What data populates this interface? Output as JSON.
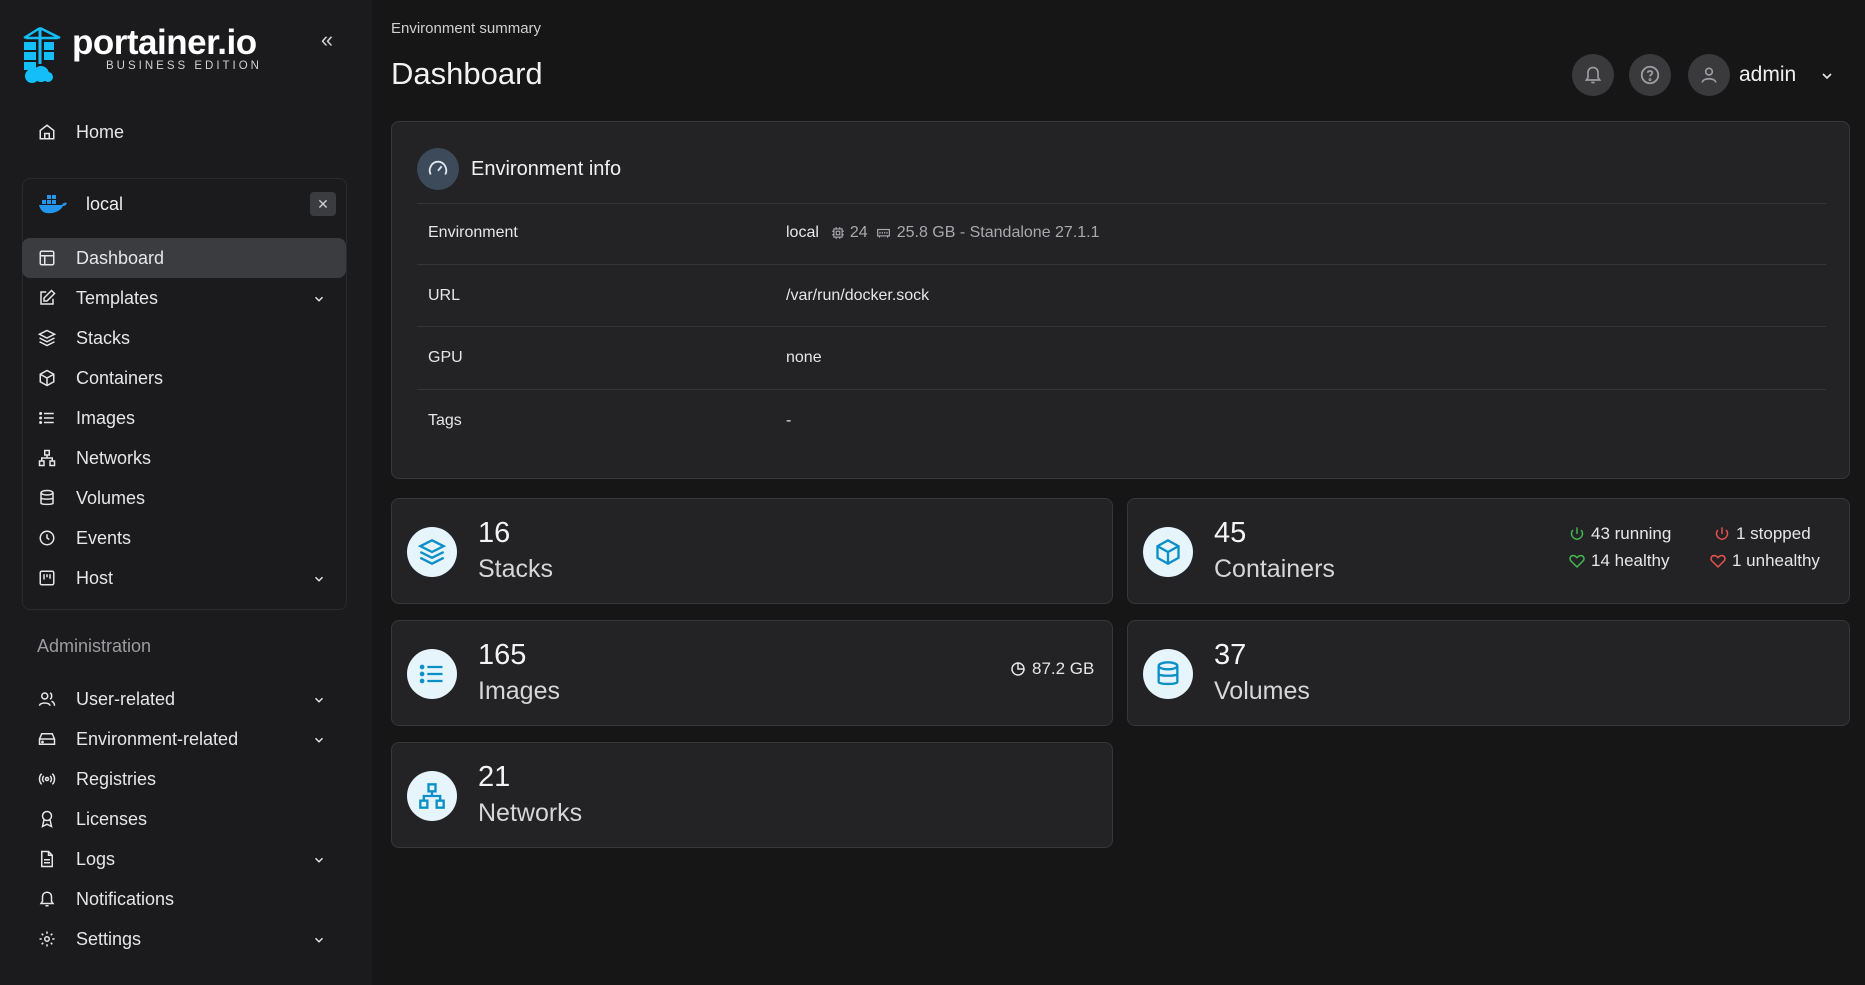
{
  "brand": {
    "title": "portainer.io",
    "subtitle": "BUSINESS EDITION"
  },
  "sidebar": {
    "home": "Home",
    "environment": {
      "name": "local",
      "items": [
        {
          "label": "Dashboard",
          "active": true
        },
        {
          "label": "Templates",
          "expandable": true
        },
        {
          "label": "Stacks"
        },
        {
          "label": "Containers"
        },
        {
          "label": "Images"
        },
        {
          "label": "Networks"
        },
        {
          "label": "Volumes"
        },
        {
          "label": "Events"
        },
        {
          "label": "Host",
          "expandable": true
        }
      ]
    },
    "admin_header": "Administration",
    "admin_items": [
      {
        "label": "User-related",
        "expandable": true
      },
      {
        "label": "Environment-related",
        "expandable": true
      },
      {
        "label": "Registries"
      },
      {
        "label": "Licenses"
      },
      {
        "label": "Logs",
        "expandable": true
      },
      {
        "label": "Notifications"
      },
      {
        "label": "Settings",
        "expandable": true
      }
    ]
  },
  "header": {
    "breadcrumb": "Environment summary",
    "title": "Dashboard",
    "user": "admin"
  },
  "env_info": {
    "title": "Environment info",
    "rows": [
      {
        "key": "Environment",
        "value": "local",
        "cpu": "24",
        "memory": "25.8 GB - Standalone 27.1.1"
      },
      {
        "key": "URL",
        "value": "/var/run/docker.sock"
      },
      {
        "key": "GPU",
        "value": "none"
      },
      {
        "key": "Tags",
        "value": "-"
      }
    ]
  },
  "stats": {
    "stacks": {
      "count": "16",
      "label": "Stacks"
    },
    "containers": {
      "count": "45",
      "label": "Containers",
      "running": "43 running",
      "stopped": "1 stopped",
      "healthy": "14 healthy",
      "unhealthy": "1 unhealthy"
    },
    "images": {
      "count": "165",
      "label": "Images",
      "size": "87.2 GB"
    },
    "volumes": {
      "count": "37",
      "label": "Volumes"
    },
    "networks": {
      "count": "21",
      "label": "Networks"
    }
  },
  "colors": {
    "accent": "#0a8fc7",
    "running": "#3fb950",
    "stopped": "#e5534b"
  }
}
